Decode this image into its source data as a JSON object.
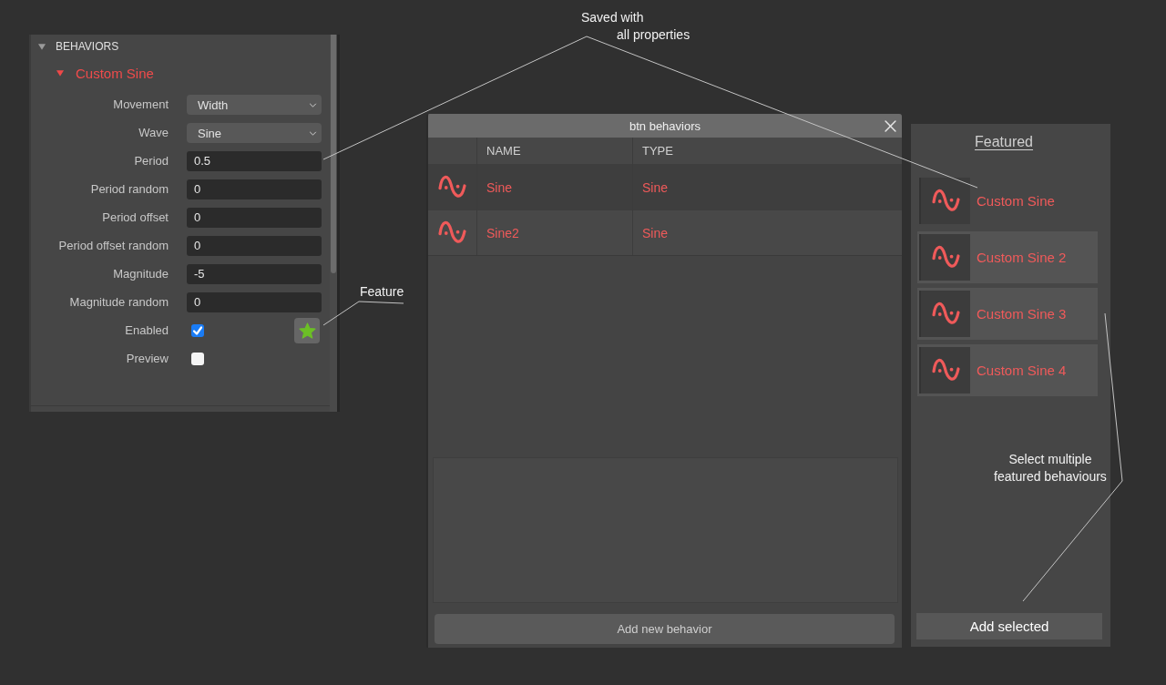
{
  "inspector": {
    "section": {
      "title": "BEHAVIORS",
      "expanded": true
    },
    "behavior": {
      "name": "Custom Sine",
      "expanded": true,
      "fields": [
        {
          "kind": "dropdown",
          "label": "Movement",
          "value": "Width"
        },
        {
          "kind": "dropdown",
          "label": "Wave",
          "value": "Sine"
        },
        {
          "kind": "input",
          "label": "Period",
          "value": "0.5"
        },
        {
          "kind": "input",
          "label": "Period random",
          "value": "0"
        },
        {
          "kind": "input",
          "label": "Period offset",
          "value": "0"
        },
        {
          "kind": "input",
          "label": "Period offset random",
          "value": "0"
        },
        {
          "kind": "input",
          "label": "Magnitude",
          "value": "-5"
        },
        {
          "kind": "input",
          "label": "Magnitude random",
          "value": "0"
        },
        {
          "kind": "checkbox",
          "label": "Enabled",
          "checked": true,
          "feature_button": true
        },
        {
          "kind": "checkbox",
          "label": "Preview",
          "checked": false
        }
      ]
    }
  },
  "dialog": {
    "title": "btn behaviors",
    "columns": [
      "NAME",
      "TYPE"
    ],
    "rows": [
      {
        "name": "Sine",
        "type": "Sine"
      },
      {
        "name": "Sine2",
        "type": "Sine"
      }
    ],
    "button": "Add new behavior"
  },
  "featured": {
    "title": "Featured",
    "items": [
      {
        "name": "Custom Sine",
        "selected": false
      },
      {
        "name": "Custom Sine 2",
        "selected": true
      },
      {
        "name": "Custom Sine 3",
        "selected": true
      },
      {
        "name": "Custom Sine 4",
        "selected": true
      }
    ],
    "button": "Add selected"
  },
  "annotations": [
    {
      "lines": [
        "Saved with",
        "all properties"
      ]
    },
    {
      "lines": [
        "Feature"
      ]
    },
    {
      "lines": [
        "Select multiple",
        "featured behaviours"
      ]
    }
  ]
}
